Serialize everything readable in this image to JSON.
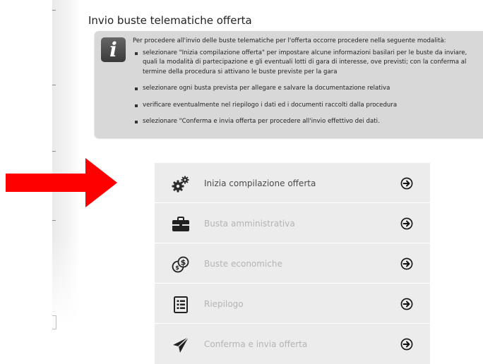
{
  "page": {
    "title": "Invio buste telematiche offerta"
  },
  "info": {
    "icon": "info-icon",
    "intro": "Per procedere all'invio delle buste telematiche per l'offerta occorre procedere nella seguente modalità:",
    "steps": [
      {
        "line1": "selezionare \"Inizia compilazione offerta\" per impostare alcune informazioni basilari per le buste da inviare,",
        "line2": "quali la modalità di partecipazione e gli eventuali lotti di gara di interesse, ove previsti; con la conferma al",
        "line3": "termine della procedura si attivano le buste previste per la gara"
      },
      {
        "line1": "selezionare ogni busta prevista per allegare e salvare la documentazione relativa"
      },
      {
        "line1": "verificare eventualmente nel riepilogo i dati ed i documenti raccolti dalla procedura"
      },
      {
        "line1": "selezionare \"Conferma e invia offerta per procedere all'invio effettivo dei dati."
      }
    ]
  },
  "menu": {
    "items": [
      {
        "label": "Inizia compilazione offerta",
        "icon": "gears-icon",
        "enabled": true
      },
      {
        "label": "Busta amministrativa",
        "icon": "briefcase-icon",
        "enabled": false
      },
      {
        "label": "Buste economiche",
        "icon": "coins-icon",
        "enabled": false
      },
      {
        "label": "Riepilogo",
        "icon": "list-document-icon",
        "enabled": false
      },
      {
        "label": "Conferma e invia offerta",
        "icon": "paper-plane-icon",
        "enabled": false
      }
    ],
    "go_icon": "arrow-right-circle-icon"
  },
  "colors": {
    "annotation_arrow": "#ff0000",
    "panel_bg": "#ececec",
    "info_bg": "#d8d8d8",
    "active_text": "#4a4a4a",
    "disabled_text": "#b4b4b4"
  }
}
